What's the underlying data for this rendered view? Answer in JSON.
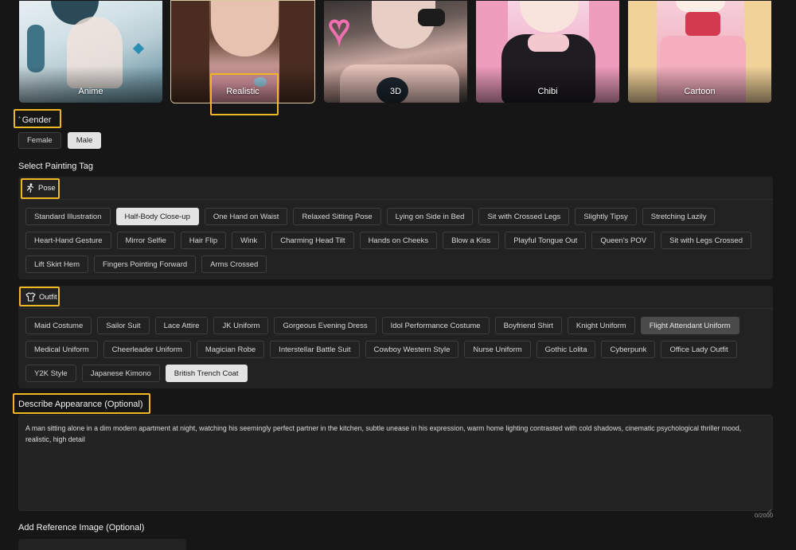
{
  "styles": [
    {
      "label": "Anime"
    },
    {
      "label": "Realistic"
    },
    {
      "label": "3D"
    },
    {
      "label": "Chibi"
    },
    {
      "label": "Cartoon"
    }
  ],
  "gender": {
    "title": "Gender",
    "required_mark": "*",
    "options": [
      "Female",
      "Male"
    ],
    "selected": "Male"
  },
  "painting_tag_title": "Select Painting Tag",
  "pose": {
    "title": "Pose :",
    "tags": [
      "Standard Illustration",
      "Half-Body Close-up",
      "One Hand on Waist",
      "Relaxed Sitting Pose",
      "Lying on Side in Bed",
      "Sit with Crossed Legs",
      "Slightly Tipsy",
      "Stretching Lazily",
      "Heart-Hand Gesture",
      "Mirror Selfie",
      "Hair Flip",
      "Wink",
      "Charming Head Tilt",
      "Hands on Cheeks",
      "Blow a Kiss",
      "Playful Tongue Out",
      "Queen's POV",
      "Sit with Legs Crossed",
      "Lift Skirt Hem",
      "Fingers Pointing Forward",
      "Arms Crossed"
    ],
    "selected": "Half-Body Close-up"
  },
  "outfit": {
    "title": "Outfit",
    "tags": [
      "Maid Costume",
      "Sailor Suit",
      "Lace Attire",
      "JK Uniform",
      "Gorgeous Evening Dress",
      "Idol Performance Costume",
      "Boyfriend Shirt",
      "Knight Uniform",
      "Flight Attendant Uniform",
      "Medical Uniform",
      "Cheerleader Uniform",
      "Magician Robe",
      "Interstellar Battle Suit",
      "Cowboy Western Style",
      "Nurse Uniform",
      "Gothic Lolita",
      "Cyberpunk",
      "Office Lady Outfit",
      "Y2K Style",
      "Japanese Kimono",
      "British Trench Coat"
    ],
    "selected": "British Trench Coat",
    "hovered": "Flight Attendant Uniform"
  },
  "appearance": {
    "title": "Describe Appearance (Optional)",
    "value": "A man sitting alone in a dim modern apartment at night, watching his seemingly perfect partner in the kitchen, subtle unease in his expression, warm home lighting contrasted with cold shadows, cinematic psychological thriller mood, realistic, high detail",
    "counter": "0/2000"
  },
  "reference": {
    "title": "Add Reference Image (Optional)"
  },
  "colors": {
    "highlight": "#f1b722",
    "panel": "#222222",
    "background": "#161616"
  }
}
